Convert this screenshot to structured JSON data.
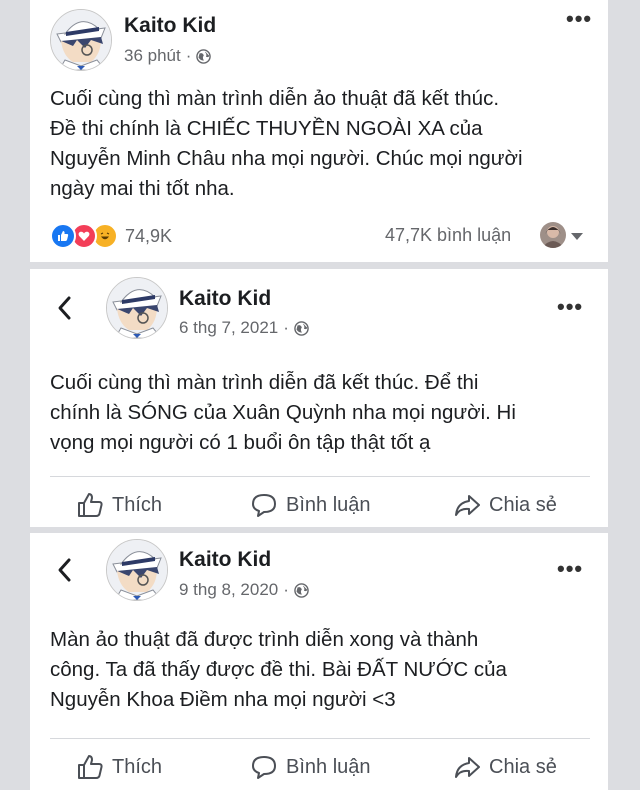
{
  "posts": [
    {
      "author": "Kaito Kid",
      "time": "36 phút",
      "text": "Cuối cùng thì màn trình diễn ảo thuật đã kết thúc.\nĐề thi chính là CHIẾC THUYỀN NGOÀI XA của\nNguyễn Minh Châu nha mọi người. Chúc mọi người\nngày mai thi tốt nha.",
      "reaction_count": "74,9K",
      "comment_count": "47,7K bình luận"
    },
    {
      "author": "Kaito Kid",
      "time": "6 thg 7, 2021",
      "text": "Cuối cùng thì màn trình diễn đã kết thúc. Để thi\nchính là SÓNG của Xuân Quỳnh nha mọi người. Hi\nvọng mọi người có 1 buổi ôn tập thật tốt ạ"
    },
    {
      "author": "Kaito Kid",
      "time": "9 thg 8, 2020",
      "text": "Màn ảo thuật đã được trình diễn xong và thành\ncông. Ta đã thấy được đề thi. Bài ĐẤT NƯỚC của\nNguyễn Khoa Điềm nha mọi người <3"
    }
  ],
  "actions": {
    "like": "Thích",
    "comment": "Bình luận",
    "share": "Chia sẻ"
  },
  "icons": {
    "avatar": "kaito-kid-avatar",
    "globe": "globe-icon",
    "more": "more-options-icon",
    "back": "back-arrow-icon",
    "like": "thumbs-up-icon",
    "comment": "comment-bubble-icon",
    "share": "share-arrow-icon"
  },
  "colors": {
    "like_blue": "#1877f2",
    "love_red": "#f33e58",
    "haha_yellow": "#f7b125",
    "meta_gray": "#65676b"
  }
}
